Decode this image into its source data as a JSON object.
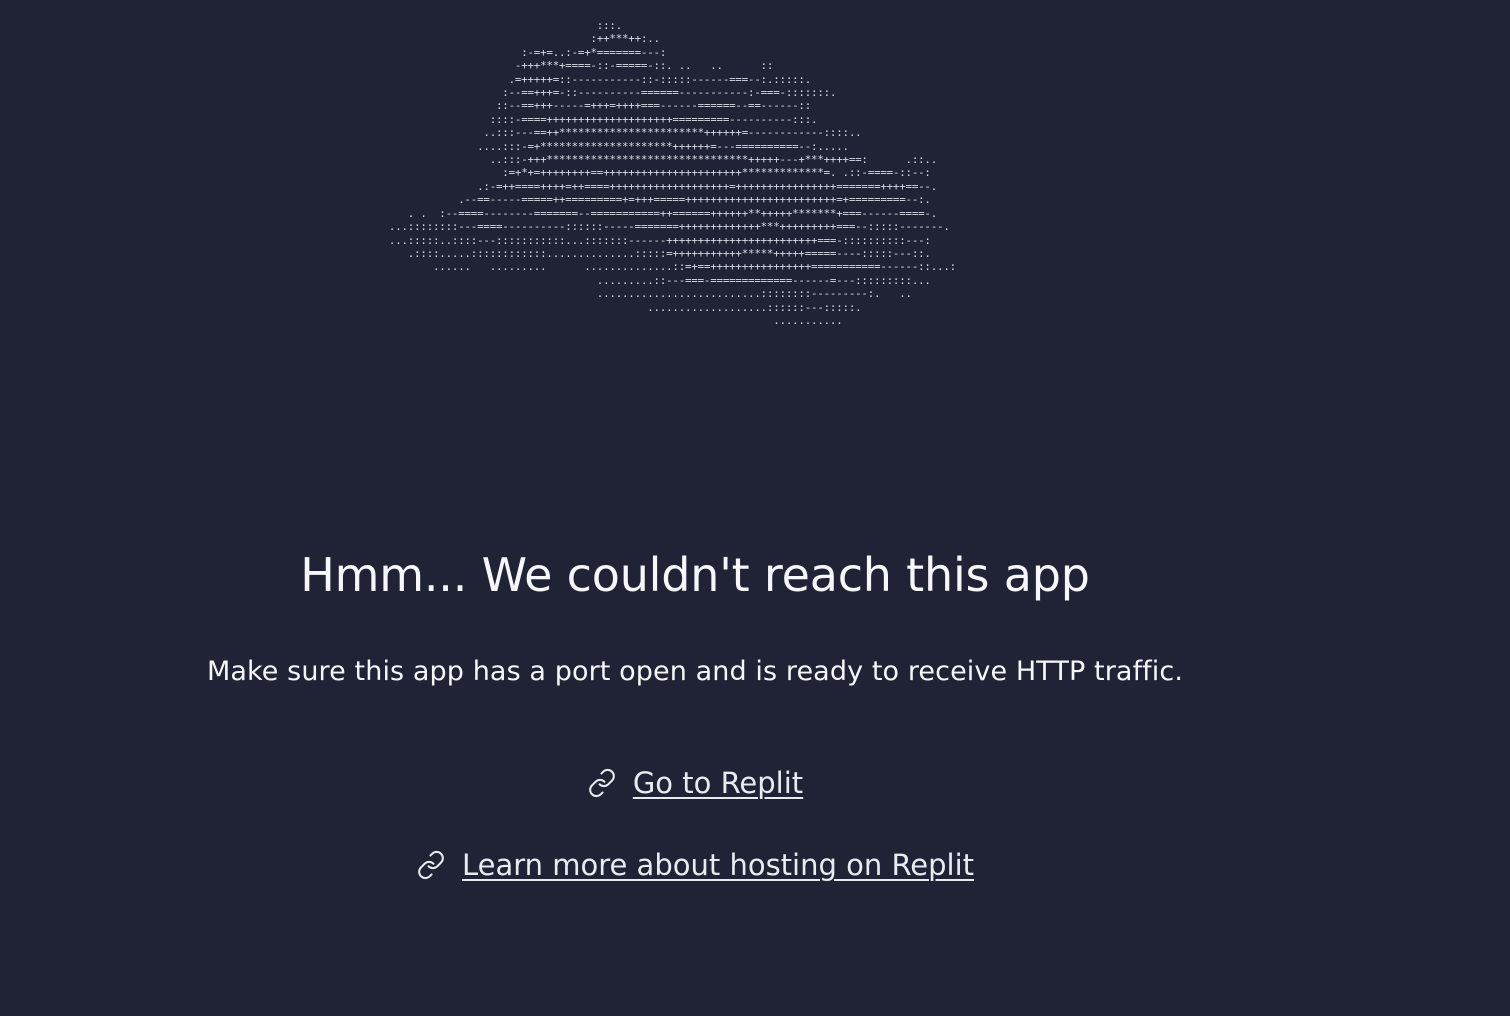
{
  "ascii_art": [
    "                                    :::.",
    "                                   :++***++:..",
    "                        :-=+=..:-=+*=======---:",
    "                       -+++***+====-::-=====-::. ..   ..      ::",
    "                      .=+++++=::-----------::-:::::------===--:.:::::.",
    "                     :--==+++=-::----------======-----------:-===-:::::::.",
    "                    ::--==+++-----=+++=++++===------======--==------::",
    "                   ::::-====++++++++++++++++++++=========----------:::.",
    "                  ..:::---==++***********************++++++=------------::::..",
    "                 ....:::-=+*********************++++++=---==========--:.....",
    "                   ..:::-+++********************************+++++---+***++++==:      .::..",
    "                     :=+*+=++++++++==++++++++++++++++++++++*************=. .::-====-::--:",
    "                 .:-=++====++++=++====+++++++++++++++++++=++++++++++++++++=======++++==--.",
    "              .--==-----=====++=========+=+++=====++++++++++++++++++++++++=+=========--:.",
    "      . .  :--====--------=======--===========++======++++++**+++++*******+===------====-.",
    "   ...::::::::---====----------::::::-----=======+++++++++++++***+++++++++===--:::::-------.",
    "   ...:::::..::::---:::::::::::...:::::::------++++++++++++++++++++++++===-::::::::::---:",
    "      .::::.....::::::::::::..............:::::=+++++++++++*****+++++=====----:::::---::.",
    "          ......   .........      ..............::=+==++++++++++++++++===========------::...:",
    "                                    .........::---===-=============------=---:::::::::...",
    "                                    ..........................::::::::---------:.   ..",
    "                                            ...................::::::---:::::.",
    "                                                                ..........."
  ],
  "headline": "Hmm... We couldn't reach this app",
  "subtext": "Make sure this app has a port open and is ready to receive HTTP traffic.",
  "links": [
    {
      "label": "Go to Replit",
      "icon": "link-icon"
    },
    {
      "label": "Learn more about hosting on Replit",
      "icon": "link-icon"
    }
  ],
  "colors": {
    "background": "#1f2335",
    "text": "#f5f7fb",
    "link": "#e8ebf2",
    "ascii": "#d9dde8"
  }
}
